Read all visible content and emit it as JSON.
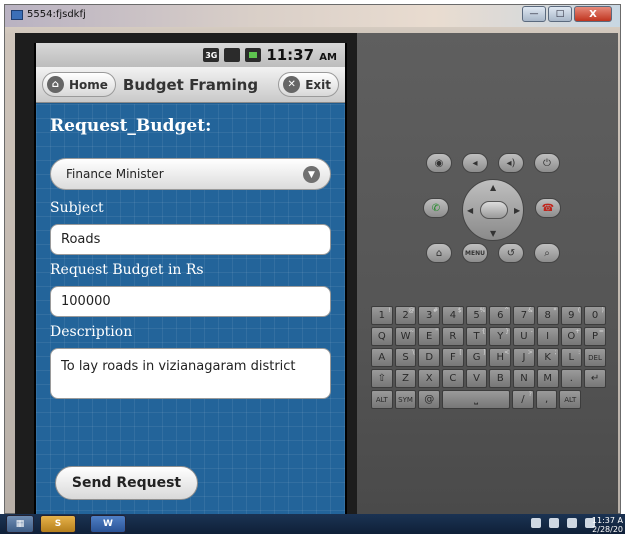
{
  "window": {
    "title": "5554:fjsdkfj",
    "min_label": "—",
    "max_label": "□",
    "close_label": "X"
  },
  "status_bar": {
    "time": "11:37",
    "ampm": "AM",
    "net_label": "3G"
  },
  "app_header": {
    "home_label": "Home",
    "title": "Budget Framing",
    "exit_label": "Exit"
  },
  "form": {
    "heading": "Request_Budget:",
    "recipient_select": "Finance Minister",
    "subject_label": "Subject",
    "subject_value": "Roads",
    "amount_label": "Request Budget in Rs",
    "amount_value": "100000",
    "description_label": "Description",
    "description_value": "To lay roads in vizianagaram district",
    "send_label": "Send Request"
  },
  "emulator": {
    "menu_label": "MENU",
    "keyboard": {
      "row1": [
        {
          "k": "1",
          "s": "!"
        },
        {
          "k": "2",
          "s": "@"
        },
        {
          "k": "3",
          "s": "#"
        },
        {
          "k": "4",
          "s": "$"
        },
        {
          "k": "5",
          "s": "%"
        },
        {
          "k": "6",
          "s": "^"
        },
        {
          "k": "7",
          "s": "&"
        },
        {
          "k": "8",
          "s": "*"
        },
        {
          "k": "9",
          "s": "("
        },
        {
          "k": "0",
          "s": ")"
        }
      ],
      "row2": [
        {
          "k": "Q",
          "s": ""
        },
        {
          "k": "W",
          "s": "~"
        },
        {
          "k": "E",
          "s": "\""
        },
        {
          "k": "R",
          "s": ""
        },
        {
          "k": "T",
          "s": "{"
        },
        {
          "k": "Y",
          "s": "}"
        },
        {
          "k": "U",
          "s": "-"
        },
        {
          "k": "I",
          "s": ""
        },
        {
          "k": "O",
          "s": "+"
        },
        {
          "k": "P",
          "s": "="
        }
      ],
      "row3": [
        {
          "k": "A",
          "s": ""
        },
        {
          "k": "S",
          "s": "\\"
        },
        {
          "k": "D",
          "s": ""
        },
        {
          "k": "F",
          "s": "["
        },
        {
          "k": "G",
          "s": "]"
        },
        {
          "k": "H",
          "s": "<"
        },
        {
          "k": "J",
          "s": ">"
        },
        {
          "k": "K",
          "s": ";"
        },
        {
          "k": "L",
          "s": ":"
        },
        {
          "k": "DEL",
          "s": ""
        }
      ],
      "row4": [
        {
          "k": "⇧",
          "s": ""
        },
        {
          "k": "Z",
          "s": ""
        },
        {
          "k": "X",
          "s": ""
        },
        {
          "k": "C",
          "s": ""
        },
        {
          "k": "V",
          "s": ""
        },
        {
          "k": "B",
          "s": ""
        },
        {
          "k": "N",
          "s": ""
        },
        {
          "k": "M",
          "s": ""
        },
        {
          "k": ".",
          "s": ""
        },
        {
          "k": "↵",
          "s": ""
        }
      ],
      "row5": [
        {
          "k": "ALT",
          "s": ""
        },
        {
          "k": "SYM",
          "s": ""
        },
        {
          "k": "@",
          "s": ""
        },
        {
          "k": "⎵",
          "s": ""
        },
        {
          "k": "/",
          "s": "?"
        },
        {
          "k": ",",
          "s": ""
        },
        {
          "k": "ALT",
          "s": ""
        }
      ]
    }
  },
  "taskbar": {
    "clock_time": "11:37 A",
    "clock_date": "2/28/20"
  },
  "colors": {
    "content_blue": "#23649a",
    "header_gray": "#d0d0d0",
    "emulator_gray": "#555555"
  },
  "icons": [
    "home-icon",
    "exit-icon",
    "dropdown-icon",
    "camera-icon",
    "volume-down-icon",
    "volume-up-icon",
    "power-icon",
    "call-icon",
    "end-call-icon",
    "home-hw-icon",
    "back-icon",
    "search-icon"
  ]
}
